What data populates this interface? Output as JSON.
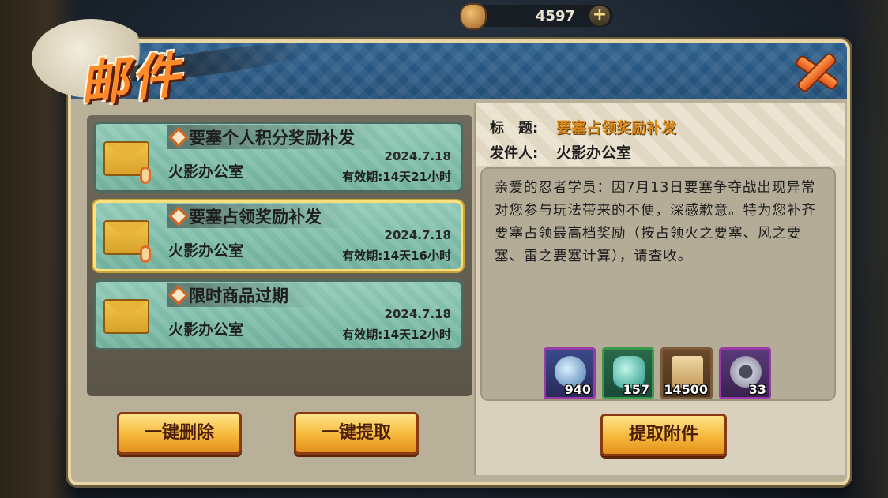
{
  "topbar": {
    "res1_value": "4597",
    "plus_label": "+"
  },
  "title": {
    "text": "邮件"
  },
  "mails": [
    {
      "subject": "要塞个人积分奖励补发",
      "sender": "火影办公室",
      "date": "2024.7.18",
      "expire": "有效期:14天21小时",
      "has_attachment": true
    },
    {
      "subject": "要塞占领奖励补发",
      "sender": "火影办公室",
      "date": "2024.7.18",
      "expire": "有效期:14天16小时",
      "has_attachment": true
    },
    {
      "subject": "限时商品过期",
      "sender": "火影办公室",
      "date": "2024.7.18",
      "expire": "有效期:14天12小时",
      "has_attachment": false
    }
  ],
  "buttons": {
    "delete_all": "一键删除",
    "claim_all": "一键提取",
    "claim_attachment": "提取附件"
  },
  "detail": {
    "title_label": "标　题:",
    "title_value": "要塞占领奖励补发",
    "sender_label": "发件人:",
    "sender_value": "火影办公室",
    "body": "亲爱的忍者学员：因7月13日要塞争夺战出现异常对您参与玩法带来的不便，深感歉意。特为您补齐要塞占领最高档奖励（按占领火之要塞、风之要塞、雷之要塞计算），请查收。"
  },
  "rewards": [
    {
      "icon": "taiji-orb-icon",
      "count": "940",
      "border": "#9a3aa8"
    },
    {
      "icon": "jade-stone-icon",
      "count": "157",
      "border": "#3a9a4a"
    },
    {
      "icon": "scroll-icon",
      "count": "14500",
      "border": "#7a5a3a"
    },
    {
      "icon": "shuriken-coin-icon",
      "count": "33",
      "border": "#9a3aa8"
    }
  ],
  "colors": {
    "accent": "#ff8a2a",
    "header": "#2c5f8c",
    "mail_bg": "#8fc9b6",
    "button": "#f6b83a"
  }
}
